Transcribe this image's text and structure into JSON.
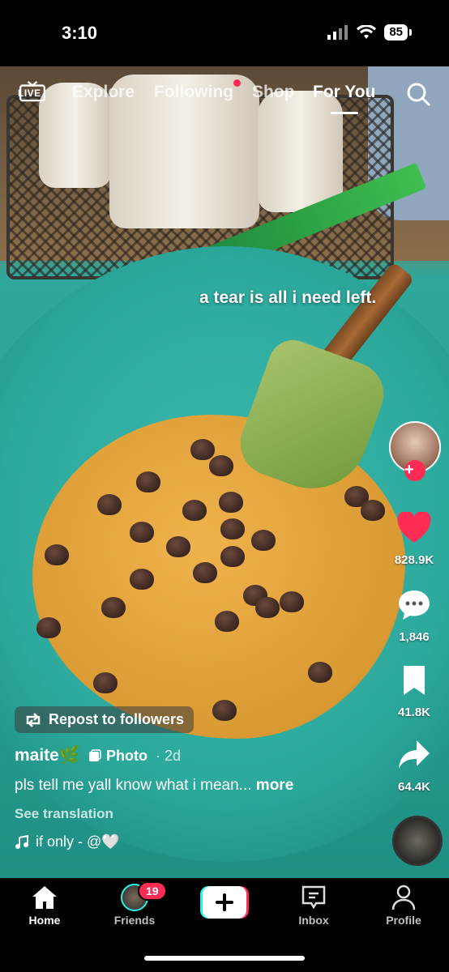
{
  "status_bar": {
    "time": "3:10",
    "battery": "85"
  },
  "top_nav": {
    "live_label": "LIVE",
    "tabs": [
      {
        "label": "Explore",
        "active": false
      },
      {
        "label": "Following",
        "active": false,
        "has_dot": true
      },
      {
        "label": "Shop",
        "active": false
      },
      {
        "label": "For You",
        "active": true
      }
    ]
  },
  "post": {
    "overlay_caption": "a tear is all i need left.",
    "repost_label": "Repost to followers",
    "username": "maite🌿",
    "type_tag": "Photo",
    "age": "· 2d",
    "description": "pls tell me yall know what i mean...",
    "more_label": "more",
    "translation_label": "See translation",
    "sound": "if only - @🤍"
  },
  "actions": {
    "likes": "828.9K",
    "comments": "1,846",
    "saves": "41.8K",
    "shares": "64.4K"
  },
  "bottom_nav": {
    "items": [
      {
        "label": "Home",
        "active": true
      },
      {
        "label": "Friends",
        "active": false
      },
      {
        "label": "",
        "active": false
      },
      {
        "label": "Inbox",
        "active": false
      },
      {
        "label": "Profile",
        "active": false
      }
    ],
    "friends_badge": "19"
  },
  "colors": {
    "accent": "#fe2c55",
    "background": "#000000",
    "text": "#ffffff"
  }
}
